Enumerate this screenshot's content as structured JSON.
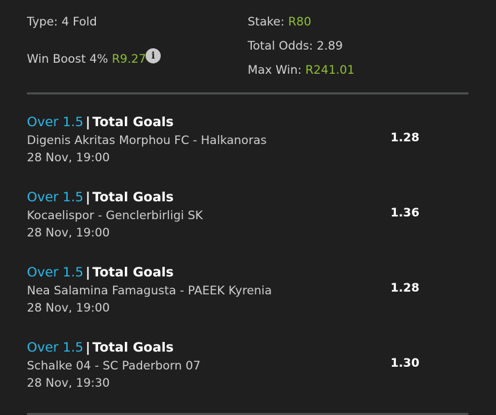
{
  "summary": {
    "type_label": "Type:",
    "type_value": "4 Fold",
    "boost_label": "Win Boost 4%",
    "boost_value": "R9.27",
    "stake_label": "Stake:",
    "stake_value": "R80",
    "odds_label": "Total Odds:",
    "odds_value": "2.89",
    "maxwin_label": "Max Win:",
    "maxwin_value": "R241.01",
    "info_icon": "info-icon"
  },
  "bets": [
    {
      "selection": "Over 1.5",
      "separator": "|",
      "market": "Total Goals",
      "event": "Digenis Akritas Morphou FC - Halkanoras",
      "time": "28 Nov, 19:00",
      "odds": "1.28"
    },
    {
      "selection": "Over 1.5",
      "separator": "|",
      "market": "Total Goals",
      "event": "Kocaelispor - Genclerbirligi SK",
      "time": "28 Nov, 19:00",
      "odds": "1.36"
    },
    {
      "selection": "Over 1.5",
      "separator": "|",
      "market": "Total Goals",
      "event": "Nea Salamina Famagusta - PAEEK Kyrenia",
      "time": "28 Nov, 19:00",
      "odds": "1.28"
    },
    {
      "selection": "Over 1.5",
      "separator": "|",
      "market": "Total Goals",
      "event": "Schalke 04 - SC Paderborn 07",
      "time": "28 Nov, 19:30",
      "odds": "1.30"
    }
  ],
  "colors": {
    "background": "#1f1f1f",
    "accent_green": "#8fbf2f",
    "selection_blue": "#2bb8e6",
    "divider": "#4d4f4f"
  }
}
